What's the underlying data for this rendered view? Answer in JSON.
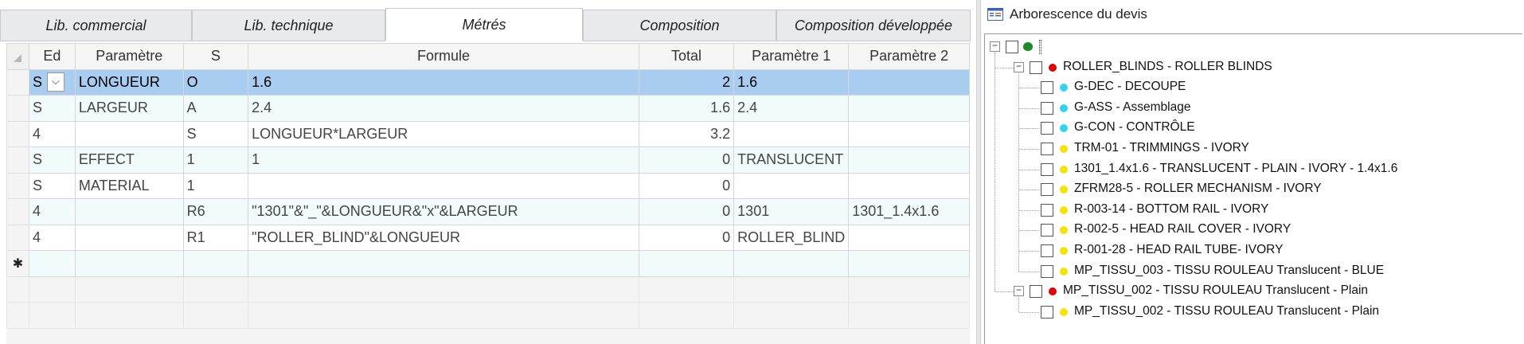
{
  "tabs": [
    {
      "label": "Lib. commercial"
    },
    {
      "label": "Lib. technique"
    },
    {
      "label": "Métrés"
    },
    {
      "label": "Composition"
    },
    {
      "label": "Composition développée"
    }
  ],
  "grid": {
    "headers": [
      "Ed",
      "Paramètre",
      "S",
      "Formule",
      "Total",
      "Paramètre 1",
      "Paramètre 2"
    ],
    "rows": [
      [
        "S",
        "LONGUEUR",
        "O",
        "1.6",
        "2",
        "1.6",
        ""
      ],
      [
        "S",
        "LARGEUR",
        "A",
        "2.4",
        "1.6",
        "2.4",
        ""
      ],
      [
        "4",
        "",
        "S",
        "LONGUEUR*LARGEUR",
        "3.2",
        "",
        ""
      ],
      [
        "S",
        "EFFECT",
        "1",
        "1",
        "0",
        "TRANSLUCENT",
        ""
      ],
      [
        "S",
        "MATERIAL",
        "1",
        "",
        "0",
        "",
        ""
      ],
      [
        "4",
        "",
        "R6",
        "\"1301\"&\"_\"&LONGUEUR&\"x\"&LARGEUR",
        "0",
        "1301",
        "1301_1.4x1.6"
      ],
      [
        "4",
        "",
        "R1",
        "\"ROLLER_BLIND\"&LONGUEUR",
        "0",
        "ROLLER_BLIND",
        ""
      ]
    ],
    "new_row_marker": "✱"
  },
  "tree": {
    "title": "Arborescence du devis",
    "nodes": [
      {
        "label": "ROLLER_BLINDS - ROLLER BLINDS",
        "color": "#e00000"
      },
      {
        "label": "G-DEC - DECOUPE",
        "color": "#2fd4f0"
      },
      {
        "label": "G-ASS - Assemblage",
        "color": "#2fd4f0"
      },
      {
        "label": "G-CON - CONTRÔLE",
        "color": "#2fd4f0"
      },
      {
        "label": " TRM-01 - TRIMMINGS - IVORY",
        "color": "#f5e300"
      },
      {
        "label": "1301_1.4x1.6 - TRANSLUCENT - PLAIN - IVORY - 1.4x1.6",
        "color": "#f5e300"
      },
      {
        "label": "ZFRM28-5 - ROLLER MECHANISM - IVORY",
        "color": "#f5e300"
      },
      {
        "label": "R-003-14 - BOTTOM RAIL - IVORY",
        "color": "#f5e300"
      },
      {
        "label": "R-002-5 - HEAD RAIL COVER - IVORY",
        "color": "#f5e300"
      },
      {
        "label": "R-001-28 - HEAD RAIL TUBE- IVORY",
        "color": "#f5e300"
      },
      {
        "label": "MP_TISSU_003 - TISSU ROULEAU Translucent - BLUE",
        "color": "#f5e300"
      },
      {
        "label": "MP_TISSU_002 - TISSU ROULEAU Translucent - Plain",
        "color": "#e00000"
      },
      {
        "label": "MP_TISSU_002 - TISSU ROULEAU Translucent - Plain",
        "color": "#f5e300"
      }
    ]
  },
  "colors": {
    "selection": "#a9cdf0",
    "alt_row": "#f2fbfc"
  }
}
